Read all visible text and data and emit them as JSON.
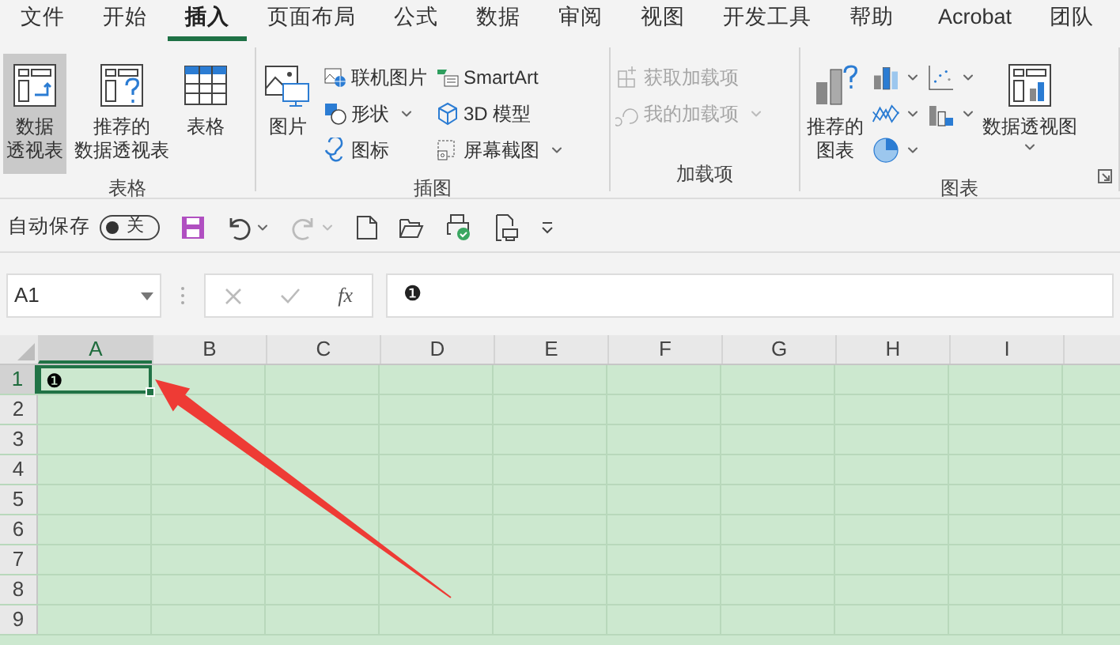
{
  "menu_tabs": [
    {
      "label": "文件",
      "selected": false
    },
    {
      "label": "开始",
      "selected": false
    },
    {
      "label": "插入",
      "selected": true
    },
    {
      "label": "页面布局",
      "selected": false
    },
    {
      "label": "公式",
      "selected": false
    },
    {
      "label": "数据",
      "selected": false
    },
    {
      "label": "审阅",
      "selected": false
    },
    {
      "label": "视图",
      "selected": false
    },
    {
      "label": "开发工具",
      "selected": false
    },
    {
      "label": "帮助",
      "selected": false
    },
    {
      "label": "Acrobat",
      "selected": false
    },
    {
      "label": "团队",
      "selected": false
    }
  ],
  "ribbon": {
    "groups": [
      {
        "label": "表格",
        "dialog_launcher": false,
        "items": [
          {
            "kind": "large",
            "lines": [
              "数据",
              "透视表"
            ],
            "selected": true,
            "dropdown": false
          },
          {
            "kind": "large",
            "lines": [
              "推荐的",
              "数据透视表"
            ],
            "selected": false,
            "dropdown": false
          },
          {
            "kind": "large",
            "lines": [
              "表格"
            ],
            "selected": false,
            "dropdown": false
          }
        ]
      },
      {
        "label": "插图",
        "dialog_launcher": false,
        "items": [
          {
            "kind": "large",
            "lines": [
              "图片"
            ],
            "selected": false,
            "dropdown": false
          },
          {
            "kind": "stack",
            "items": [
              {
                "kind": "small",
                "label": "联机图片",
                "dropdown": false,
                "disabled": false
              },
              {
                "kind": "small",
                "label": "形状",
                "dropdown": true,
                "disabled": false
              },
              {
                "kind": "small",
                "label": "图标",
                "dropdown": false,
                "disabled": false
              }
            ]
          },
          {
            "kind": "stack",
            "items": [
              {
                "kind": "small",
                "label": "SmartArt",
                "dropdown": false,
                "disabled": false
              },
              {
                "kind": "small",
                "label": "3D 模型",
                "dropdown": false,
                "disabled": false
              },
              {
                "kind": "small",
                "label": "屏幕截图",
                "dropdown": true,
                "disabled": false
              }
            ]
          }
        ]
      },
      {
        "label": "加载项",
        "dialog_launcher": false,
        "items": [
          {
            "kind": "stack",
            "items": [
              {
                "kind": "small",
                "label": "获取加载项",
                "dropdown": false,
                "disabled": true
              },
              {
                "kind": "small",
                "label": "我的加载项",
                "dropdown": true,
                "disabled": true
              }
            ]
          }
        ]
      },
      {
        "label": "图表",
        "dialog_launcher": true,
        "items": [
          {
            "kind": "large",
            "lines": [
              "推荐的",
              "图表"
            ],
            "selected": false,
            "dropdown": false
          },
          {
            "kind": "stack",
            "items": [
              {
                "kind": "icon",
                "dropdown": true,
                "disabled": false
              },
              {
                "kind": "icon",
                "dropdown": true,
                "disabled": false
              },
              {
                "kind": "icon",
                "dropdown": true,
                "disabled": false
              }
            ]
          },
          {
            "kind": "stack",
            "items": [
              {
                "kind": "icon",
                "dropdown": true,
                "disabled": false
              },
              {
                "kind": "icon",
                "dropdown": true,
                "disabled": false
              }
            ]
          },
          {
            "kind": "large",
            "lines": [
              "数据透视图"
            ],
            "selected": false,
            "dropdown": true
          }
        ]
      }
    ]
  },
  "quick_access": {
    "autosave": {
      "label": "自动保存",
      "on": false,
      "state_label": "关"
    },
    "buttons": [
      {
        "kind": "save",
        "dropdown": false,
        "disabled": false
      },
      {
        "kind": "undo",
        "dropdown": true,
        "disabled": false
      },
      {
        "kind": "redo",
        "dropdown": true,
        "disabled": true
      },
      {
        "kind": "new",
        "dropdown": false,
        "disabled": false
      },
      {
        "kind": "open",
        "dropdown": false,
        "disabled": false
      },
      {
        "kind": "print-preview",
        "dropdown": false,
        "disabled": false
      },
      {
        "kind": "print",
        "dropdown": false,
        "disabled": false
      },
      {
        "kind": "customize",
        "dropdown": false,
        "disabled": false
      }
    ]
  },
  "formula_bar": {
    "name_box": "A1",
    "fx": "fx",
    "value": "❶"
  },
  "sheet": {
    "columns": [
      {
        "label": "A",
        "selected": true
      },
      {
        "label": "B",
        "selected": false
      },
      {
        "label": "C",
        "selected": false
      },
      {
        "label": "D",
        "selected": false
      },
      {
        "label": "E",
        "selected": false
      },
      {
        "label": "F",
        "selected": false
      },
      {
        "label": "G",
        "selected": false
      },
      {
        "label": "H",
        "selected": false
      },
      {
        "label": "I",
        "selected": false
      }
    ],
    "rows": [
      {
        "label": "1",
        "selected": true,
        "cells": [
          {
            "value": "❶",
            "selected": true
          }
        ]
      },
      {
        "label": "2",
        "selected": false
      },
      {
        "label": "3",
        "selected": false
      },
      {
        "label": "4",
        "selected": false
      },
      {
        "label": "5",
        "selected": false
      },
      {
        "label": "6",
        "selected": false
      },
      {
        "label": "7",
        "selected": false
      },
      {
        "label": "8",
        "selected": false
      },
      {
        "label": "9",
        "selected": false
      }
    ]
  }
}
